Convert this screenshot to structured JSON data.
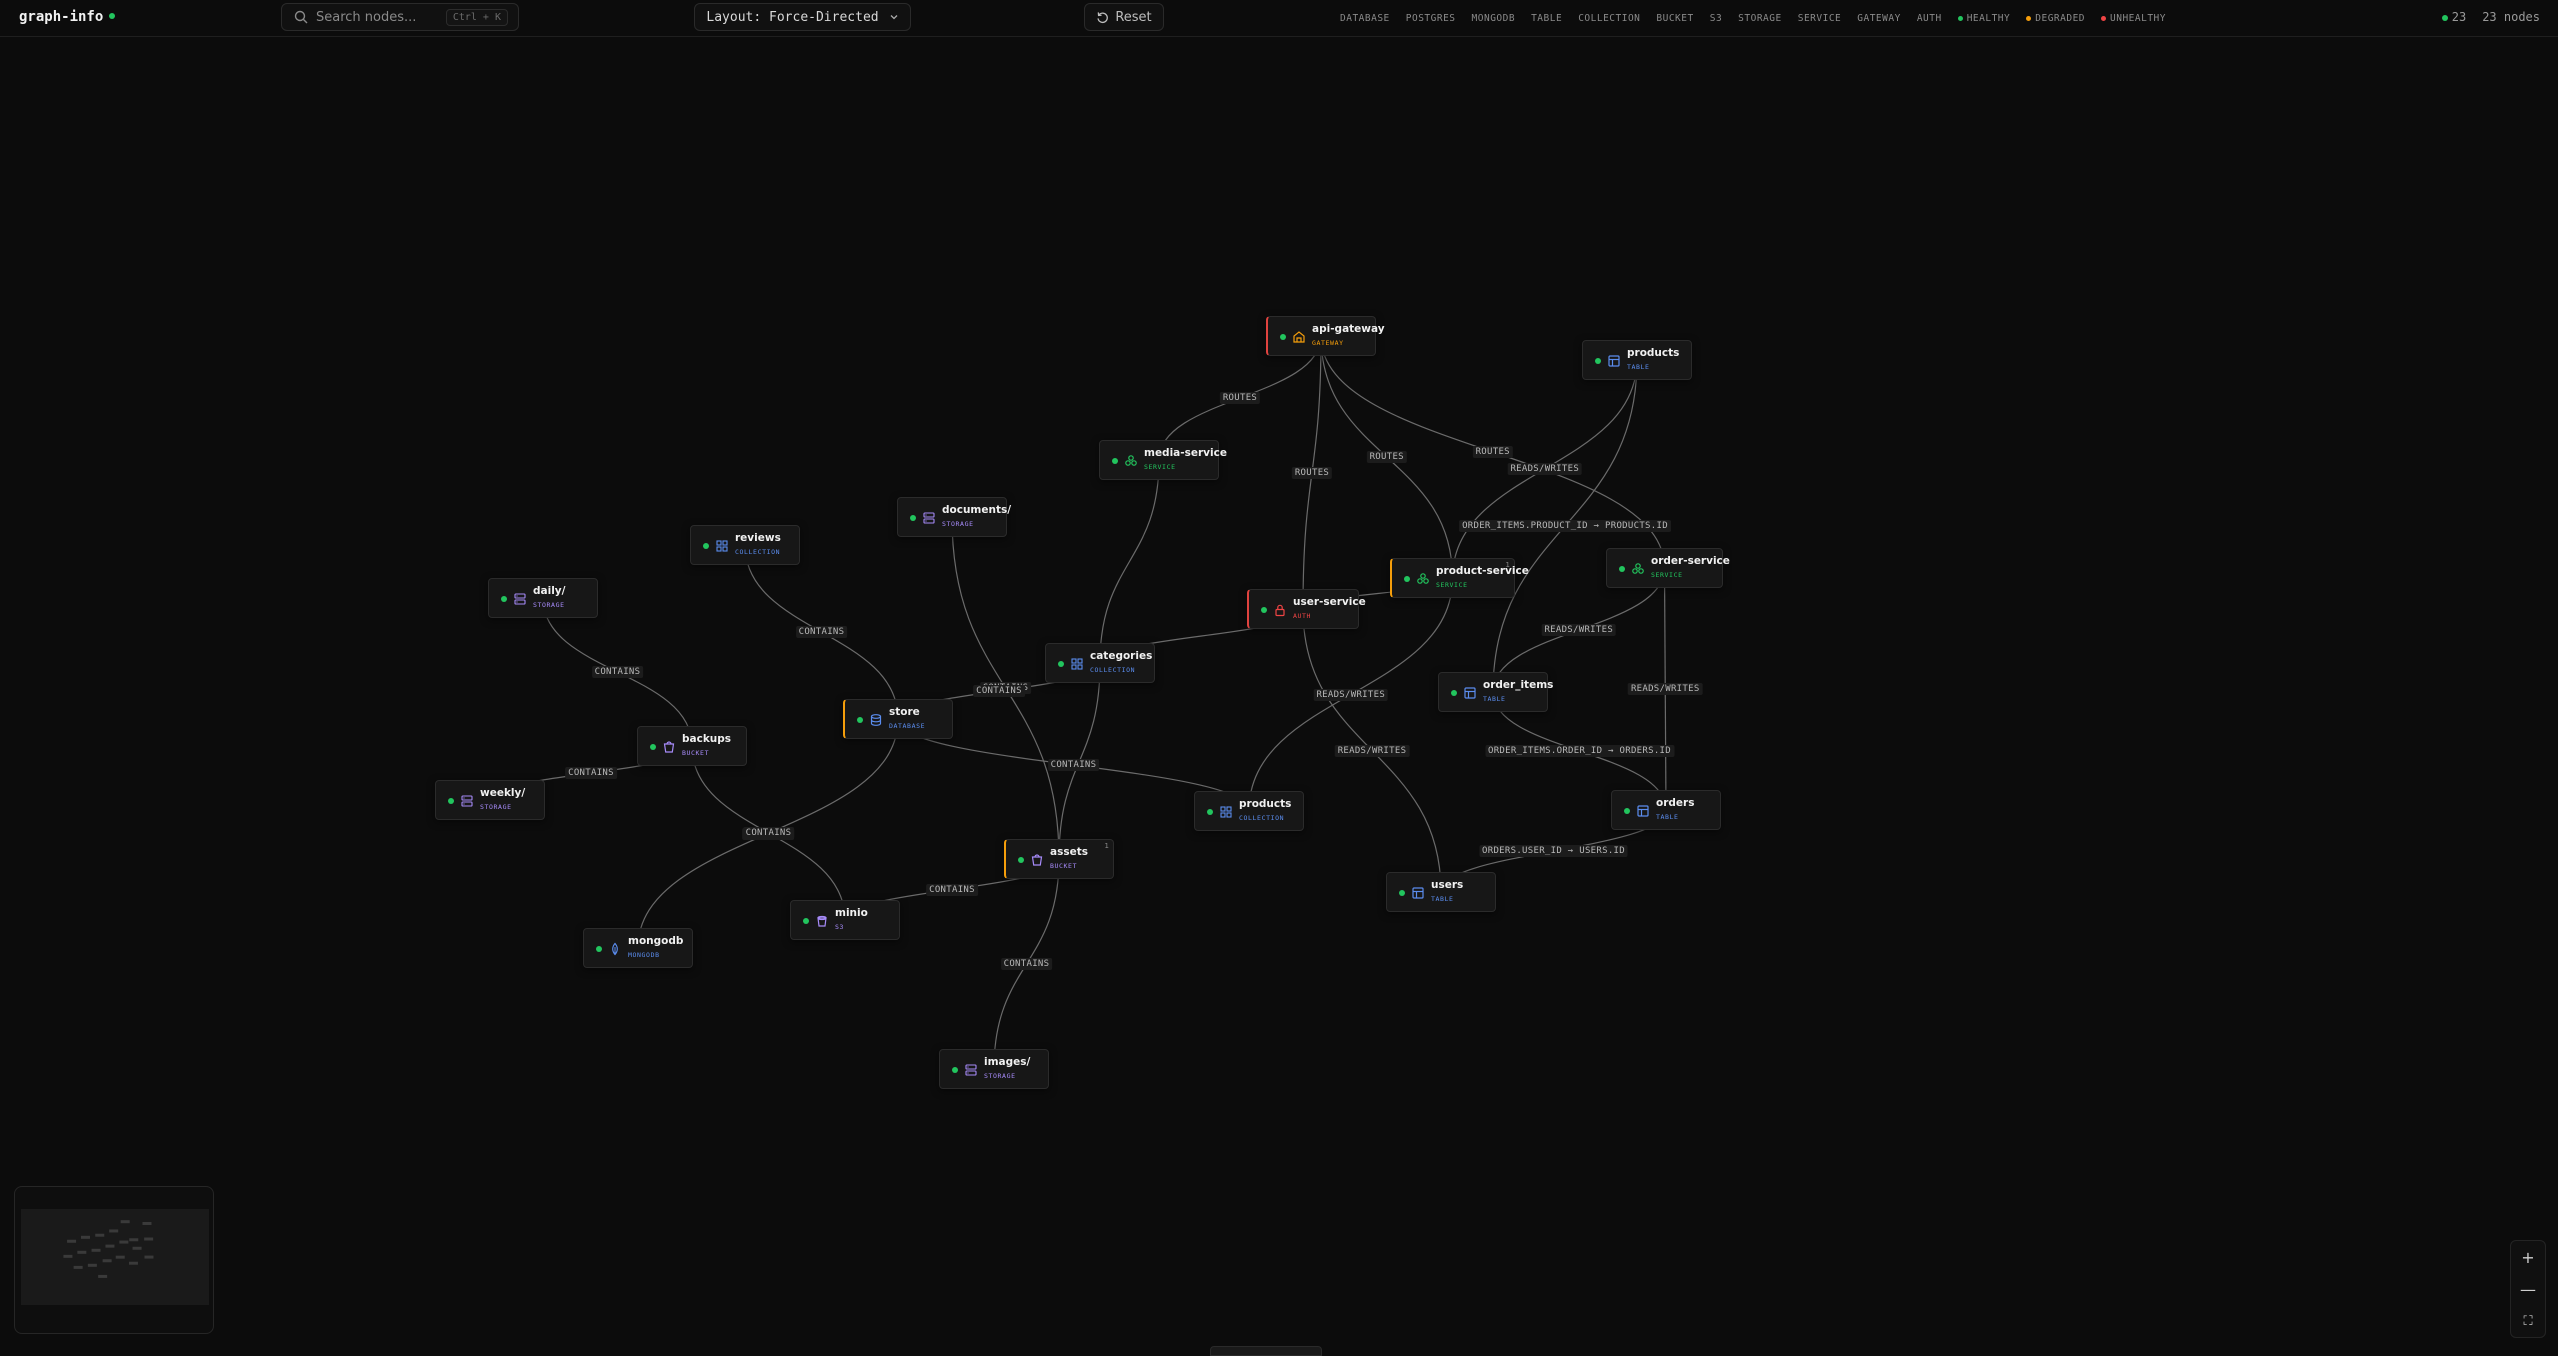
{
  "app": {
    "title": "graph-info"
  },
  "search": {
    "placeholder": "Search nodes...",
    "shortcut": "Ctrl + K"
  },
  "layout": {
    "label": "Layout: Force-Directed"
  },
  "reset": {
    "label": "Reset"
  },
  "filters": [
    {
      "label": "DATABASE"
    },
    {
      "label": "POSTGRES"
    },
    {
      "label": "MONGODB"
    },
    {
      "label": "TABLE"
    },
    {
      "label": "COLLECTION"
    },
    {
      "label": "BUCKET"
    },
    {
      "label": "S3"
    },
    {
      "label": "STORAGE"
    },
    {
      "label": "SERVICE"
    },
    {
      "label": "GATEWAY"
    },
    {
      "label": "AUTH"
    },
    {
      "label": "HEALTHY",
      "color": "#22c55e"
    },
    {
      "label": "DEGRADED",
      "color": "#f59e0b"
    },
    {
      "label": "UNHEALTHY",
      "color": "#ef4444"
    }
  ],
  "stats": {
    "healthy_count": "23",
    "nodes_label": "23 nodes"
  },
  "type_colors": {
    "GATEWAY": "#f59e0b",
    "SERVICE": "#22c55e",
    "AUTH": "#ef4444",
    "TABLE": "#5b8def",
    "COLLECTION": "#5b8def",
    "STORAGE": "#a78bfa",
    "BUCKET": "#a78bfa",
    "S3": "#a78bfa",
    "DATABASE": "#5b8def",
    "MONGODB": "#5b8def"
  },
  "nodes": [
    {
      "id": "api-gateway",
      "label": "api-gateway",
      "type": "GATEWAY",
      "icon": "gateway-icon",
      "accent": "red"
    },
    {
      "id": "products-table",
      "label": "products",
      "type": "TABLE",
      "icon": "table-icon"
    },
    {
      "id": "media-service",
      "label": "media-service",
      "type": "SERVICE",
      "icon": "service-icon"
    },
    {
      "id": "documents",
      "label": "documents/",
      "type": "STORAGE",
      "icon": "folder-icon"
    },
    {
      "id": "reviews",
      "label": "reviews",
      "type": "COLLECTION",
      "icon": "collection-icon"
    },
    {
      "id": "daily",
      "label": "daily/",
      "type": "STORAGE",
      "icon": "folder-icon"
    },
    {
      "id": "product-service",
      "label": "product-service",
      "type": "SERVICE",
      "icon": "service-icon",
      "accent": "orange",
      "badge": "1"
    },
    {
      "id": "order-service",
      "label": "order-service",
      "type": "SERVICE",
      "icon": "service-icon"
    },
    {
      "id": "user-service",
      "label": "user-service",
      "type": "AUTH",
      "icon": "lock-icon",
      "accent": "red"
    },
    {
      "id": "categories",
      "label": "categories",
      "type": "COLLECTION",
      "icon": "collection-icon"
    },
    {
      "id": "order-items",
      "label": "order_items",
      "type": "TABLE",
      "icon": "table-icon"
    },
    {
      "id": "store",
      "label": "store",
      "type": "DATABASE",
      "icon": "database-icon",
      "accent": "orange"
    },
    {
      "id": "backups",
      "label": "backups",
      "type": "BUCKET",
      "icon": "bucket-icon"
    },
    {
      "id": "weekly",
      "label": "weekly/",
      "type": "STORAGE",
      "icon": "folder-icon"
    },
    {
      "id": "products-coll",
      "label": "products",
      "type": "COLLECTION",
      "icon": "collection-icon"
    },
    {
      "id": "orders",
      "label": "orders",
      "type": "TABLE",
      "icon": "table-icon"
    },
    {
      "id": "assets",
      "label": "assets",
      "type": "BUCKET",
      "icon": "bucket-icon",
      "accent": "orange",
      "badge": "1"
    },
    {
      "id": "users",
      "label": "users",
      "type": "TABLE",
      "icon": "table-icon"
    },
    {
      "id": "minio",
      "label": "minio",
      "type": "S3",
      "icon": "s3-icon"
    },
    {
      "id": "mongodb",
      "label": "mongodb",
      "type": "MONGODB",
      "icon": "mongodb-icon"
    },
    {
      "id": "images",
      "label": "images/",
      "type": "STORAGE",
      "icon": "folder-icon"
    }
  ],
  "edges": [
    {
      "from": "api-gateway",
      "to": "media-service",
      "label": "ROUTES"
    },
    {
      "from": "api-gateway",
      "to": "user-service",
      "label": "ROUTES"
    },
    {
      "from": "api-gateway",
      "to": "product-service",
      "label": "ROUTES"
    },
    {
      "from": "api-gateway",
      "to": "order-service",
      "label": "ROUTES"
    },
    {
      "from": "products-table",
      "to": "product-service",
      "label": "READS/WRITES"
    },
    {
      "from": "products-table",
      "to": "order-items",
      "label": "ORDER_ITEMS.PRODUCT_ID → PRODUCTS.ID"
    },
    {
      "from": "order-service",
      "to": "order-items",
      "label": "READS/WRITES"
    },
    {
      "from": "order-service",
      "to": "orders",
      "label": "READS/WRITES"
    },
    {
      "from": "order-items",
      "to": "orders",
      "label": "ORDER_ITEMS.ORDER_ID → ORDERS.ID"
    },
    {
      "from": "orders",
      "to": "users",
      "label": "ORDERS.USER_ID → USERS.ID"
    },
    {
      "from": "product-service",
      "to": "products-coll",
      "label": "READS/WRITES"
    },
    {
      "from": "user-service",
      "to": "users",
      "label": "READS/WRITES"
    },
    {
      "from": "user-service",
      "to": "product-service",
      "label": ""
    },
    {
      "from": "user-service",
      "to": "categories",
      "label": ""
    },
    {
      "from": "media-service",
      "to": "categories",
      "label": ""
    },
    {
      "from": "categories",
      "to": "assets",
      "label": ""
    },
    {
      "from": "reviews",
      "to": "store",
      "label": "CONTAINS"
    },
    {
      "from": "documents",
      "to": "assets",
      "label": "CONTAINS"
    },
    {
      "from": "store",
      "to": "categories",
      "label": "CONTAINS"
    },
    {
      "from": "store",
      "to": "products-coll",
      "label": "CONTAINS"
    },
    {
      "from": "store",
      "to": "mongodb",
      "label": "CONTAINS"
    },
    {
      "from": "daily",
      "to": "backups",
      "label": "CONTAINS"
    },
    {
      "from": "backups",
      "to": "weekly",
      "label": "CONTAINS"
    },
    {
      "from": "backups",
      "to": "minio",
      "label": "CONTAINS"
    },
    {
      "from": "assets",
      "to": "minio",
      "label": "CONTAINS"
    },
    {
      "from": "assets",
      "to": "images",
      "label": "CONTAINS"
    }
  ],
  "zoom": {
    "in": "+",
    "out": "—",
    "fit": "⛶"
  }
}
